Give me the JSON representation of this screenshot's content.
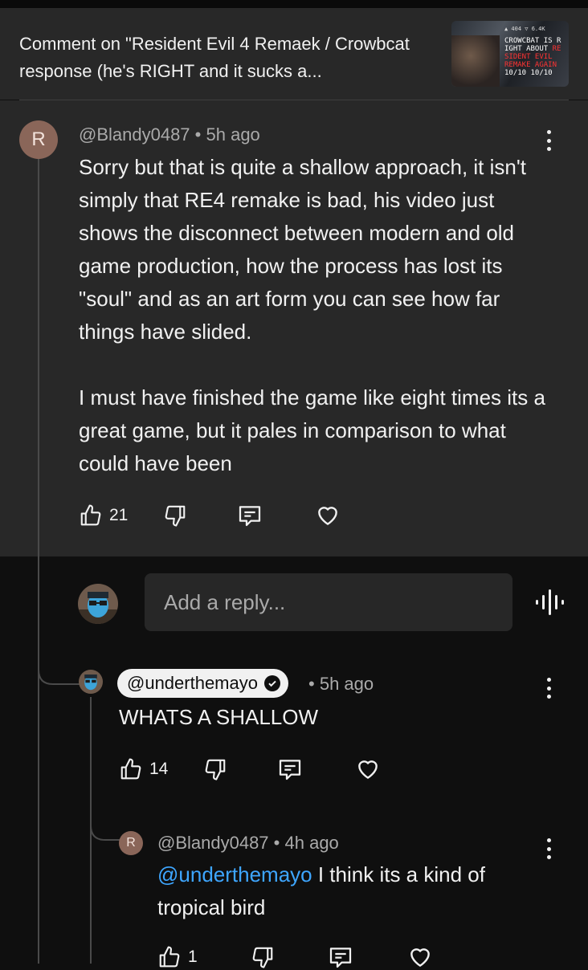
{
  "header": {
    "title": "Comment on \"Resident Evil 4 Remaek / Crowbcat response (he's RIGHT and it sucks a...",
    "thumbnail": {
      "stats": "▲ 404  ▽ 6.4K",
      "line1": "CROWCBAT IS R",
      "line2": "IGHT ABOUT",
      "line3": "RE",
      "line4": "SIDENT EVIL",
      "line5": "REMAKE AGAIN",
      "line6": "10/10 10/10"
    }
  },
  "main_comment": {
    "avatar_letter": "R",
    "author": "@Blandy0487",
    "separator": "•",
    "time": "5h ago",
    "text": "Sorry but that is quite a shallow approach, it isn't simply that RE4 remake is bad, his video just shows the disconnect between modern and old game production, how the process has lost its \"soul\" and as an art form you can see how far things have slided.\n\nI must have finished the game like eight times its a great game, but it pales in comparison to what could have been",
    "likes": "21"
  },
  "reply_input": {
    "placeholder": "Add a reply..."
  },
  "replies": [
    {
      "author": "@underthemayo",
      "verified": true,
      "separator": "•",
      "time": "5h ago",
      "text": "WHATS A SHALLOW",
      "likes": "14"
    },
    {
      "avatar_letter": "R",
      "author": "@Blandy0487",
      "separator": "•",
      "time": "4h ago",
      "mention": "@underthemayo",
      "text": " I think its a kind of tropical bird",
      "likes": "1"
    }
  ],
  "colors": {
    "mention": "#3ea6ff",
    "avatar": "#8a6659",
    "panel": "#282828",
    "background": "#0f0f0f"
  }
}
